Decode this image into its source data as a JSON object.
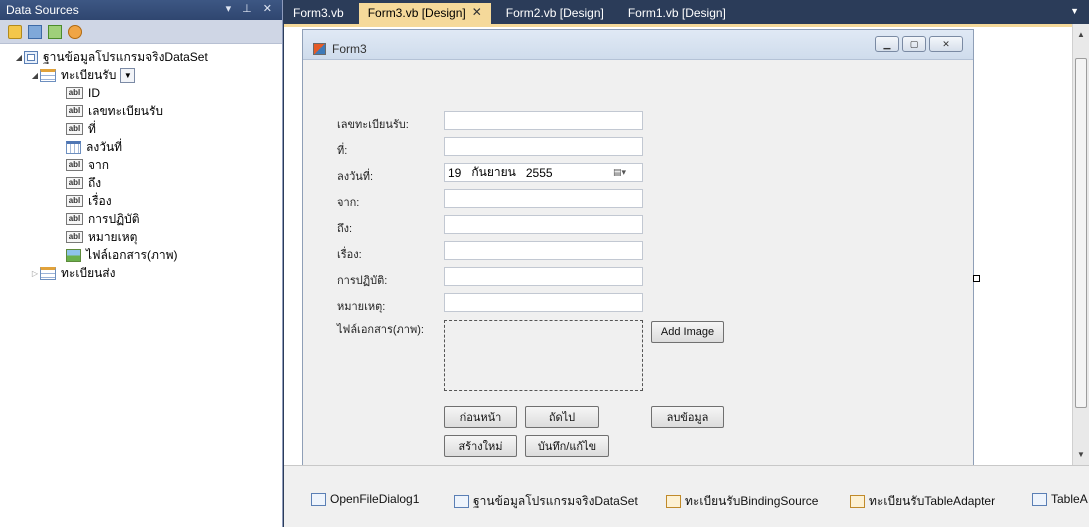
{
  "data_sources": {
    "title": "Data Sources",
    "title_controls": "▾ ⊥ ✕",
    "dataset_name": "ฐานข้อมูลโปรแกรมจริงDataSet",
    "table_received": "ทะเบียนรับ",
    "fields": [
      {
        "name": "ID",
        "icon": "abl"
      },
      {
        "name": "เลขทะเบียนรับ",
        "icon": "abl"
      },
      {
        "name": "ที่",
        "icon": "abl"
      },
      {
        "name": "ลงวันที่",
        "icon": "calendar"
      },
      {
        "name": "จาก",
        "icon": "abl"
      },
      {
        "name": "ถึง",
        "icon": "abl"
      },
      {
        "name": "เรื่อง",
        "icon": "abl"
      },
      {
        "name": "การปฏิบัติ",
        "icon": "abl"
      },
      {
        "name": "หมายเหตุ",
        "icon": "abl"
      },
      {
        "name": "ไฟล์เอกสาร(ภาพ)",
        "icon": "image"
      }
    ],
    "table_sent": "ทะเบียนส่ง"
  },
  "tabs": [
    {
      "label": "Form3.vb",
      "active": false
    },
    {
      "label": "Form3.vb [Design]",
      "active": true
    },
    {
      "label": "Form2.vb [Design]",
      "active": false
    },
    {
      "label": "Form1.vb [Design]",
      "active": false
    }
  ],
  "form": {
    "title": "Form3",
    "labels": {
      "reg_no": "เลขทะเบียนรับ:",
      "at": "ที่:",
      "date": "ลงวันที่:",
      "from": "จาก:",
      "to": "ถึง:",
      "subject": "เรื่อง:",
      "action": "การปฏิบัติ:",
      "note": "หมายเหตุ:",
      "file": "ไฟล์เอกสาร(ภาพ):"
    },
    "date_value": {
      "day": "19",
      "month": "กันยายน",
      "year": "2555"
    },
    "buttons": {
      "add_image": "Add Image",
      "previous": "ก่อนหน้า",
      "next": "ถัดไป",
      "delete": "ลบข้อมูล",
      "new": "สร้างใหม่",
      "save": "บันทึก/แก้ไข"
    }
  },
  "tray": [
    "OpenFileDialog1",
    "ฐานข้อมูลโปรแกรมจริงDataSet",
    "ทะเบียนรับBindingSource",
    "ทะเบียนรับTableAdapter",
    "TableA"
  ]
}
